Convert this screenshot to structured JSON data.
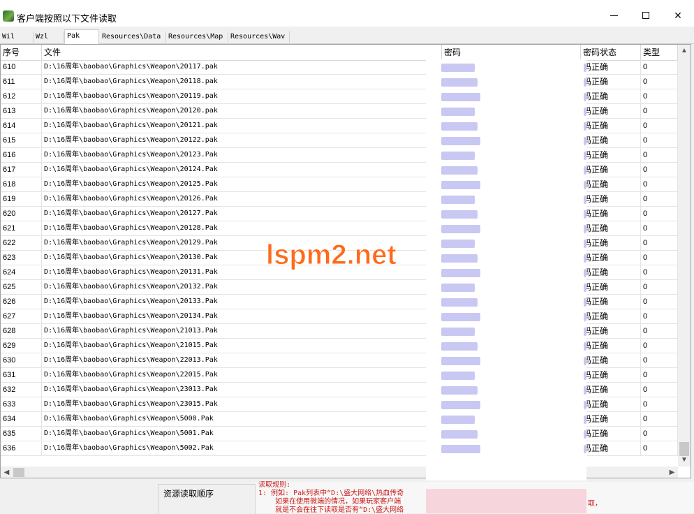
{
  "window": {
    "title": "客户端按照以下文件读取"
  },
  "tabs": [
    {
      "label": "Wil",
      "active": false
    },
    {
      "label": "Wzl",
      "active": false
    },
    {
      "label": "Pak",
      "active": true
    },
    {
      "label": "Resources\\Data",
      "active": false
    },
    {
      "label": "Resources\\Map",
      "active": false
    },
    {
      "label": "Resources\\Wav",
      "active": false
    }
  ],
  "columns": [
    {
      "label": "序号"
    },
    {
      "label": "文件"
    },
    {
      "label": "密码"
    },
    {
      "label": "密码状态"
    },
    {
      "label": "类型"
    }
  ],
  "rows": [
    {
      "index": "610",
      "file": "D:\\16周年\\baobao\\Graphics\\Weapon\\20117.pak",
      "status": "码正确",
      "type": "0"
    },
    {
      "index": "611",
      "file": "D:\\16周年\\baobao\\Graphics\\Weapon\\20118.pak",
      "status": "码正确",
      "type": "0"
    },
    {
      "index": "612",
      "file": "D:\\16周年\\baobao\\Graphics\\Weapon\\20119.pak",
      "status": "码正确",
      "type": "0"
    },
    {
      "index": "613",
      "file": "D:\\16周年\\baobao\\Graphics\\Weapon\\20120.pak",
      "status": "码正确",
      "type": "0"
    },
    {
      "index": "614",
      "file": "D:\\16周年\\baobao\\Graphics\\Weapon\\20121.pak",
      "status": "码正确",
      "type": "0"
    },
    {
      "index": "615",
      "file": "D:\\16周年\\baobao\\Graphics\\Weapon\\20122.pak",
      "status": "码正确",
      "type": "0"
    },
    {
      "index": "616",
      "file": "D:\\16周年\\baobao\\Graphics\\Weapon\\20123.Pak",
      "status": "码正确",
      "type": "0"
    },
    {
      "index": "617",
      "file": "D:\\16周年\\baobao\\Graphics\\Weapon\\20124.Pak",
      "status": "码正确",
      "type": "0"
    },
    {
      "index": "618",
      "file": "D:\\16周年\\baobao\\Graphics\\Weapon\\20125.Pak",
      "status": "码正确",
      "type": "0"
    },
    {
      "index": "619",
      "file": "D:\\16周年\\baobao\\Graphics\\Weapon\\20126.Pak",
      "status": "码正确",
      "type": "0"
    },
    {
      "index": "620",
      "file": "D:\\16周年\\baobao\\Graphics\\Weapon\\20127.Pak",
      "status": "码正确",
      "type": "0"
    },
    {
      "index": "621",
      "file": "D:\\16周年\\baobao\\Graphics\\Weapon\\20128.Pak",
      "status": "码正确",
      "type": "0"
    },
    {
      "index": "622",
      "file": "D:\\16周年\\baobao\\Graphics\\Weapon\\20129.Pak",
      "status": "码正确",
      "type": "0"
    },
    {
      "index": "623",
      "file": "D:\\16周年\\baobao\\Graphics\\Weapon\\20130.Pak",
      "status": "码正确",
      "type": "0"
    },
    {
      "index": "624",
      "file": "D:\\16周年\\baobao\\Graphics\\Weapon\\20131.Pak",
      "status": "码正确",
      "type": "0"
    },
    {
      "index": "625",
      "file": "D:\\16周年\\baobao\\Graphics\\Weapon\\20132.Pak",
      "status": "码正确",
      "type": "0"
    },
    {
      "index": "626",
      "file": "D:\\16周年\\baobao\\Graphics\\Weapon\\20133.Pak",
      "status": "码正确",
      "type": "0"
    },
    {
      "index": "627",
      "file": "D:\\16周年\\baobao\\Graphics\\Weapon\\20134.Pak",
      "status": "码正确",
      "type": "0"
    },
    {
      "index": "628",
      "file": "D:\\16周年\\baobao\\Graphics\\Weapon\\21013.Pak",
      "status": "码正确",
      "type": "0"
    },
    {
      "index": "629",
      "file": "D:\\16周年\\baobao\\Graphics\\Weapon\\21015.Pak",
      "status": "码正确",
      "type": "0"
    },
    {
      "index": "630",
      "file": "D:\\16周年\\baobao\\Graphics\\Weapon\\22013.Pak",
      "status": "码正确",
      "type": "0"
    },
    {
      "index": "631",
      "file": "D:\\16周年\\baobao\\Graphics\\Weapon\\22015.Pak",
      "status": "码正确",
      "type": "0"
    },
    {
      "index": "632",
      "file": "D:\\16周年\\baobao\\Graphics\\Weapon\\23013.Pak",
      "status": "码正确",
      "type": "0"
    },
    {
      "index": "633",
      "file": "D:\\16周年\\baobao\\Graphics\\Weapon\\23015.Pak",
      "status": "码正确",
      "type": "0"
    },
    {
      "index": "634",
      "file": "D:\\16周年\\baobao\\Graphics\\Weapon\\5000.Pak",
      "status": "码正确",
      "type": "0"
    },
    {
      "index": "635",
      "file": "D:\\16周年\\baobao\\Graphics\\Weapon\\5001.Pak",
      "status": "码正确",
      "type": "0"
    },
    {
      "index": "636",
      "file": "D:\\16周年\\baobao\\Graphics\\Weapon\\5002.Pak",
      "status": "码正确",
      "type": "0"
    }
  ],
  "bottom": {
    "order_label": "资源读取顺序",
    "rules_lines": [
      "读取规则:",
      "1: 例如: Pak列表中“D:\\盛大网络\\热血传奇",
      "    如果在使用微端的情况，如果玩家客户端",
      "    就是不会在往下读取是否有“D:\\盛大网络"
    ],
    "rules_tail": "取，"
  },
  "watermark": {
    "text": "lspm2.net",
    "color": "#ff6a1a"
  },
  "colors": {
    "rules_text": "#cc1a1a",
    "password_blur": "#c9c8f2"
  }
}
